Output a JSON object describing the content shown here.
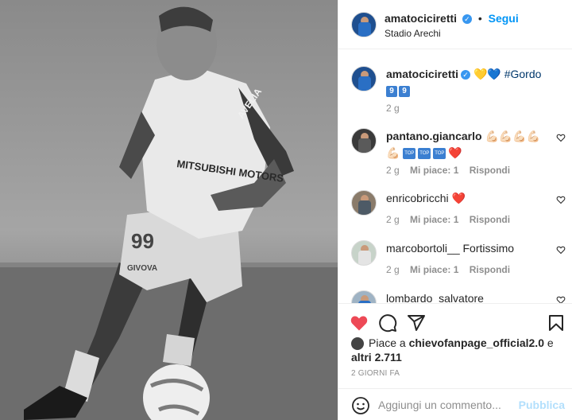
{
  "post": {
    "author": "amatociciretti",
    "follow_label": "Segui",
    "location": "Stadio Arechi",
    "caption": {
      "hearts": "💛💙",
      "hashtag": "#Gordo",
      "number_tiles": [
        "9",
        "9"
      ],
      "time": "2 g"
    }
  },
  "comments": [
    {
      "user": "pantano.giancarlo",
      "text": "💪🏻💪🏻💪🏻💪🏻",
      "text2": "💪🏻",
      "tiles": [
        "TOP",
        "TOP",
        "TOP"
      ],
      "heart": "❤️",
      "time": "2 g",
      "likes": "Mi piace: 1",
      "reply": "Rispondi"
    },
    {
      "user": "enricobricchi",
      "text": "❤️",
      "time": "2 g",
      "likes": "Mi piace: 1",
      "reply": "Rispondi"
    },
    {
      "user": "marcobortoli__",
      "text": "Fortissimo",
      "time": "2 g",
      "likes": "Mi piace: 1",
      "reply": "Rispondi"
    },
    {
      "user": "lombardo_salvatore",
      "text": "",
      "time": "",
      "likes": "",
      "reply": ""
    }
  ],
  "actions": {
    "likes_prefix": "Piace a",
    "liked_by": "chievofanpage_official2.0",
    "likes_suffix": "e",
    "likes_others": "altri 2.711",
    "date": "2 GIORNI FA"
  },
  "add_comment": {
    "placeholder": "Aggiungi un commento...",
    "publish_label": "Pubblica"
  },
  "photo": {
    "jersey_number": "99",
    "sponsor": "MITSUBISHI MOTORS",
    "kit_brand": "GIVOVA",
    "sleeve_sponsor": "AVELIA"
  },
  "colors": {
    "accent": "#0095f6",
    "like_red": "#ed4956",
    "muted": "#8e8e8e",
    "border": "#efefef"
  },
  "icons": [
    "verified-badge-icon",
    "heart-icon",
    "comment-icon",
    "share-icon",
    "bookmark-icon",
    "smile-icon"
  ]
}
